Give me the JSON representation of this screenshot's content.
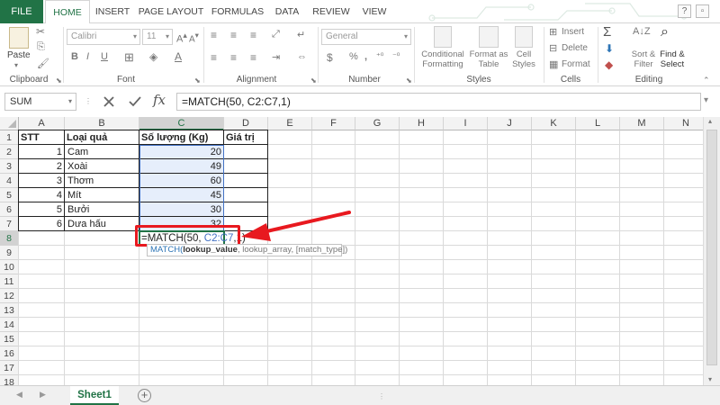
{
  "tabs": [
    "FILE",
    "HOME",
    "INSERT",
    "PAGE LAYOUT",
    "FORMULAS",
    "DATA",
    "REVIEW",
    "VIEW"
  ],
  "ribbon": {
    "paste_label": "Paste",
    "font_name": "Calibri",
    "font_size": "11",
    "number_format": "General",
    "conditional_formatting": "Conditional\nFormatting",
    "format_as_table": "Format as\nTable",
    "cell_styles": "Cell\nStyles",
    "insert": "Insert",
    "delete": "Delete",
    "format": "Format",
    "sort_filter": "Sort &\nFilter",
    "find_select": "Find &\nSelect",
    "groups": {
      "clipboard": "Clipboard",
      "font": "Font",
      "alignment": "Alignment",
      "number": "Number",
      "styles": "Styles",
      "cells": "Cells",
      "editing": "Editing"
    }
  },
  "formula_bar": {
    "name_box": "SUM",
    "formula": "=MATCH(50, C2:C7,1)"
  },
  "columns": [
    "A",
    "B",
    "C",
    "D",
    "E",
    "F",
    "G",
    "H",
    "I",
    "J",
    "K",
    "L",
    "M",
    "N"
  ],
  "rows": [
    "1",
    "2",
    "3",
    "4",
    "5",
    "6",
    "7",
    "8",
    "9",
    "10",
    "11",
    "12",
    "13",
    "14",
    "15",
    "16",
    "17",
    "18"
  ],
  "table": {
    "headers": [
      "STT",
      "Loại quả",
      "Số lượng (Kg)",
      "Giá trị"
    ],
    "rows": [
      [
        "1",
        "Cam",
        "20"
      ],
      [
        "2",
        "Xoài",
        "49"
      ],
      [
        "3",
        "Thơm",
        "60"
      ],
      [
        "4",
        "Mít",
        "45"
      ],
      [
        "5",
        "Bưởi",
        "30"
      ],
      [
        "6",
        "Dưa hấu",
        "32"
      ]
    ]
  },
  "edit_cell": {
    "prefix": "=MATCH(50, ",
    "range": "C2:C7",
    "suffix": ",1)"
  },
  "tooltip": {
    "fn": "MATCH(",
    "arg1": "lookup_value",
    "rest": ", lookup_array, [match_type])"
  },
  "sheet_tab": "Sheet1",
  "colors": {
    "excel_green": "#217346",
    "annotation_red": "#e8191f",
    "selection_fill": "#e6eefb",
    "range_ref": "#4472c4"
  }
}
